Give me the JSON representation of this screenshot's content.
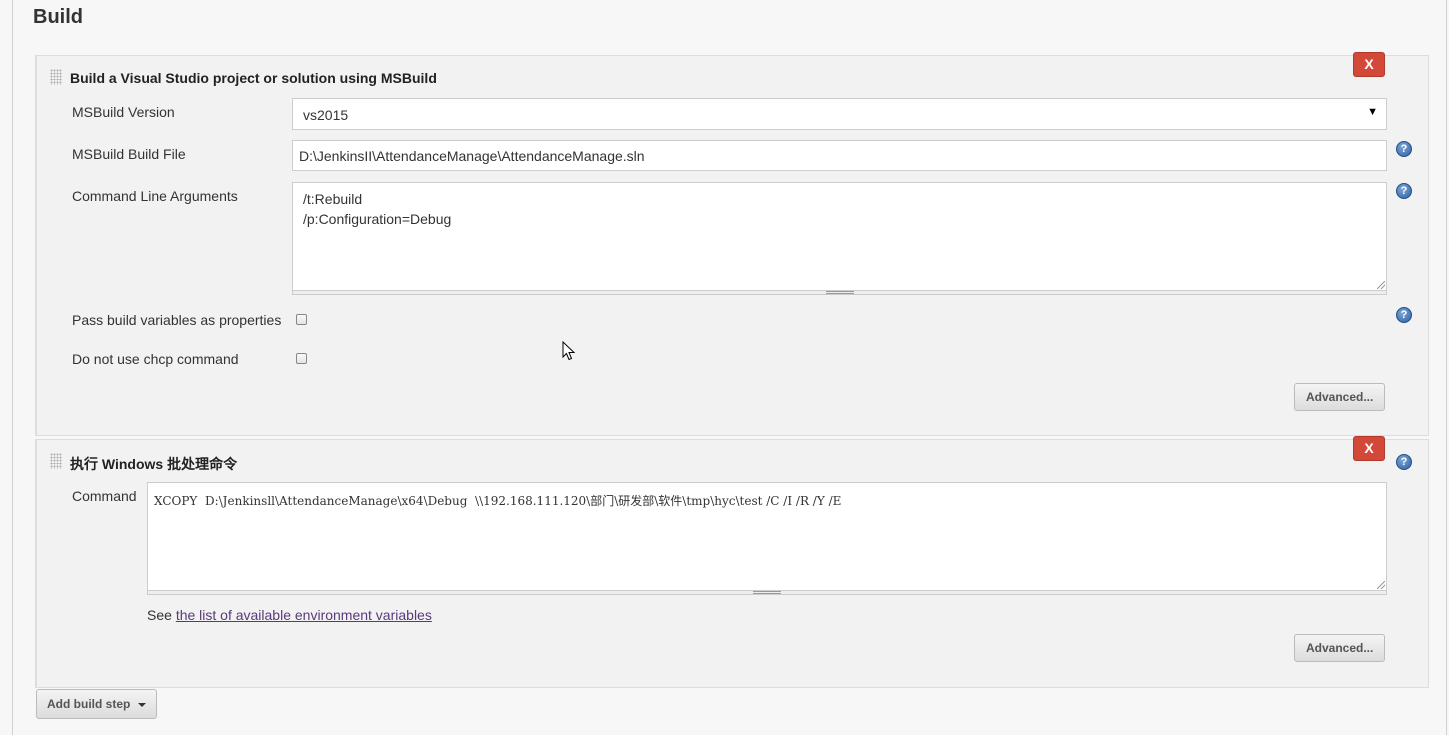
{
  "section": {
    "title": "Build"
  },
  "msbuild_step": {
    "title": "Build a Visual Studio project or solution using MSBuild",
    "delete_label": "X",
    "version": {
      "label": "MSBuild Version",
      "value": "vs2015"
    },
    "build_file": {
      "label": "MSBuild Build File",
      "value": "D:\\JenkinsII\\AttendanceManage\\AttendanceManage.sln"
    },
    "cmd_args": {
      "label": "Command Line Arguments",
      "value": "/t:Rebuild\n/p:Configuration=Debug"
    },
    "pass_vars": {
      "label": "Pass build variables as properties",
      "checked": false
    },
    "no_chcp": {
      "label": "Do not use chcp command",
      "checked": false
    },
    "advanced_label": "Advanced..."
  },
  "batch_step": {
    "title": "执行 Windows 批处理命令",
    "delete_label": "X",
    "command": {
      "label": "Command",
      "value": "XCOPY  D:\\Jenkinsll\\AttendanceManage\\x64\\Debug  \\\\192.168.111.120\\部门\\研发部\\软件\\tmp\\hyc\\test /C /I /R /Y /E"
    },
    "see_prefix": "See ",
    "env_link": "the list of available environment variables",
    "advanced_label": "Advanced..."
  },
  "add_step_label": "Add build step",
  "icons": {
    "help": "help-icon",
    "drag": "drag-handle-icon",
    "dropdown": "caret-down-icon",
    "cursor": "mouse-cursor-icon"
  },
  "colors": {
    "delete": "#d24939",
    "link": "#5a3a7a",
    "help": "#2c5f9e",
    "panel": "#f2f2f2"
  }
}
